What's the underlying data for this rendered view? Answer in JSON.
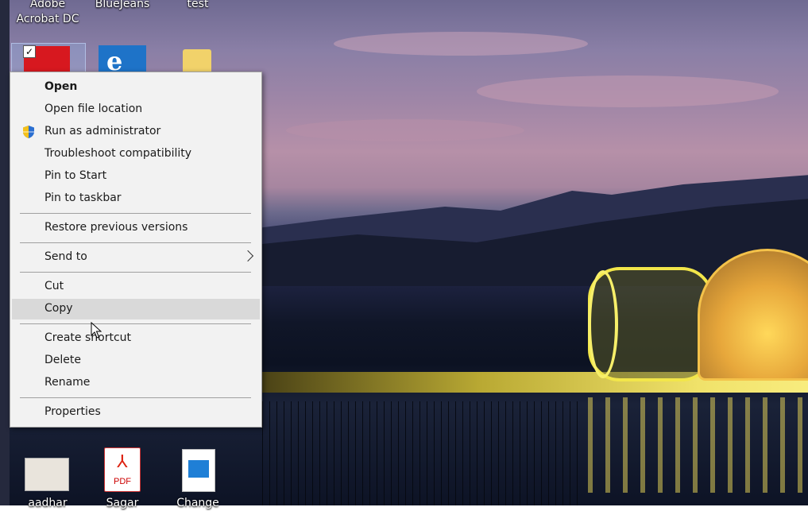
{
  "desktop": {
    "top_icons": [
      {
        "label_line1": "Adobe",
        "label_line2": "Acrobat DC",
        "icon": "acrobat-icon",
        "selected": true
      },
      {
        "label_line1": "BlueJeans",
        "icon": "edge-icon"
      },
      {
        "label_line1": "test",
        "icon": "document-icon"
      }
    ],
    "bottom_icons": [
      {
        "label": "aadhar",
        "icon": "id-card-icon"
      },
      {
        "label": "Sagar",
        "icon": "pdf-file-icon",
        "badge": "PDF"
      },
      {
        "label": "Change",
        "icon": "image-file-icon"
      }
    ]
  },
  "context_menu": {
    "items": [
      {
        "label": "Open",
        "bold": true
      },
      {
        "label": "Open file location"
      },
      {
        "label": "Run as administrator",
        "icon": "shield-icon"
      },
      {
        "label": "Troubleshoot compatibility"
      },
      {
        "label": "Pin to Start"
      },
      {
        "label": "Pin to taskbar"
      },
      {
        "label": "Restore previous versions"
      },
      {
        "label": "Send to",
        "submenu": true
      },
      {
        "label": "Cut"
      },
      {
        "label": "Copy",
        "highlighted": true
      },
      {
        "label": "Create shortcut"
      },
      {
        "label": "Delete"
      },
      {
        "label": "Rename"
      },
      {
        "label": "Properties"
      }
    ]
  },
  "colors": {
    "menu_bg": "#f2f2f2",
    "menu_highlight": "#d9d9d9",
    "acrobat_red": "#d7181f",
    "edge_blue": "#1e73c8"
  }
}
